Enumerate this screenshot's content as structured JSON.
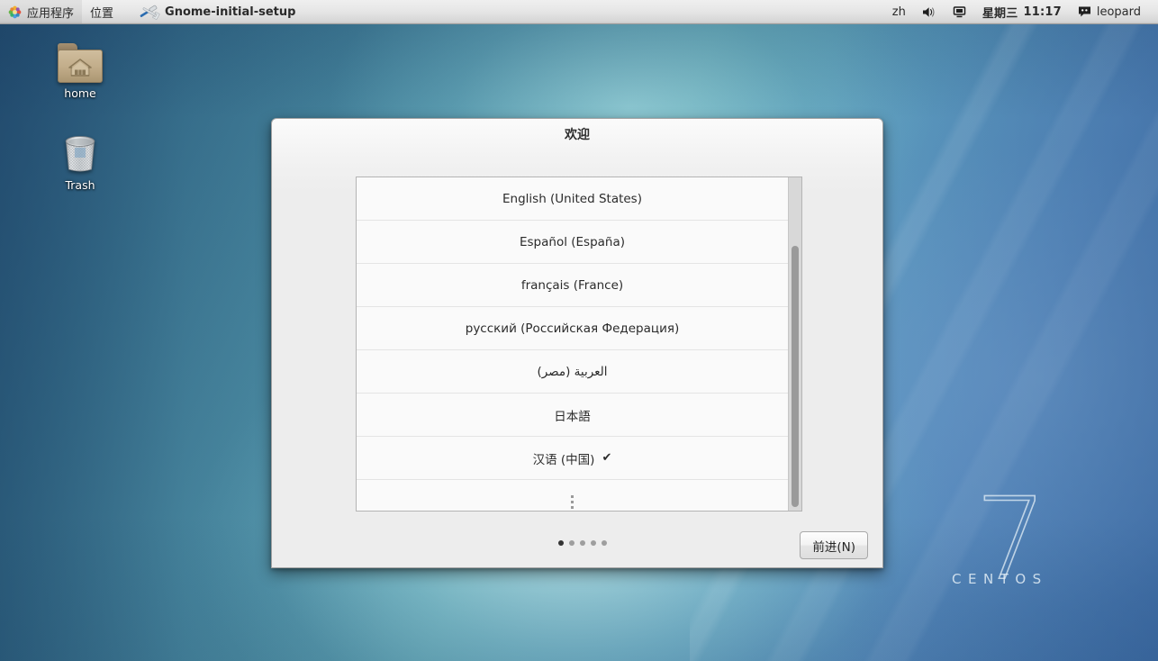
{
  "panel": {
    "applications_label": "应用程序",
    "places_label": "位置",
    "task_label": "Gnome-initial-setup",
    "task_icon": "tools-icon",
    "apps_icon": "gnome-foot-icon",
    "input_source": "zh",
    "volume_icon": "speaker-icon",
    "display_icon": "monitor-icon",
    "day_label": "星期三",
    "time_label": "11:17",
    "message_icon": "message-tray-icon",
    "user_label": "leopard"
  },
  "desktop": {
    "icons": [
      {
        "name": "home",
        "label": "home",
        "icon": "home-folder-icon"
      },
      {
        "name": "trash",
        "label": "Trash",
        "icon": "trash-can-icon"
      }
    ],
    "watermark": {
      "version": "7",
      "brand": "CENTOS"
    }
  },
  "dialog": {
    "title": "欢迎",
    "languages": [
      {
        "label": "English (United States)",
        "selected": false
      },
      {
        "label": "Español (España)",
        "selected": false
      },
      {
        "label": "français (France)",
        "selected": false
      },
      {
        "label": "русский (Российская Федерация)",
        "selected": false
      },
      {
        "label": "العربية (مصر)",
        "selected": false
      },
      {
        "label": "日本語",
        "selected": false
      },
      {
        "label": "汉语 (中国)",
        "selected": true
      }
    ],
    "more_indicator": "⋮",
    "selected_mark": "✔",
    "pagination": {
      "total": 5,
      "current": 1
    },
    "next_label": "前进(N)"
  },
  "colors": {
    "panel_text": "#2a2a2a",
    "dialog_bg": "#ededed",
    "list_bg": "#fafafa",
    "scroll_thumb": "#9a9a9a",
    "dot_active": "#343434",
    "dot_inactive": "#9e9e9e",
    "folder_icon": "#c2ad8a",
    "wallpaper_primary": "#62a8b6"
  }
}
